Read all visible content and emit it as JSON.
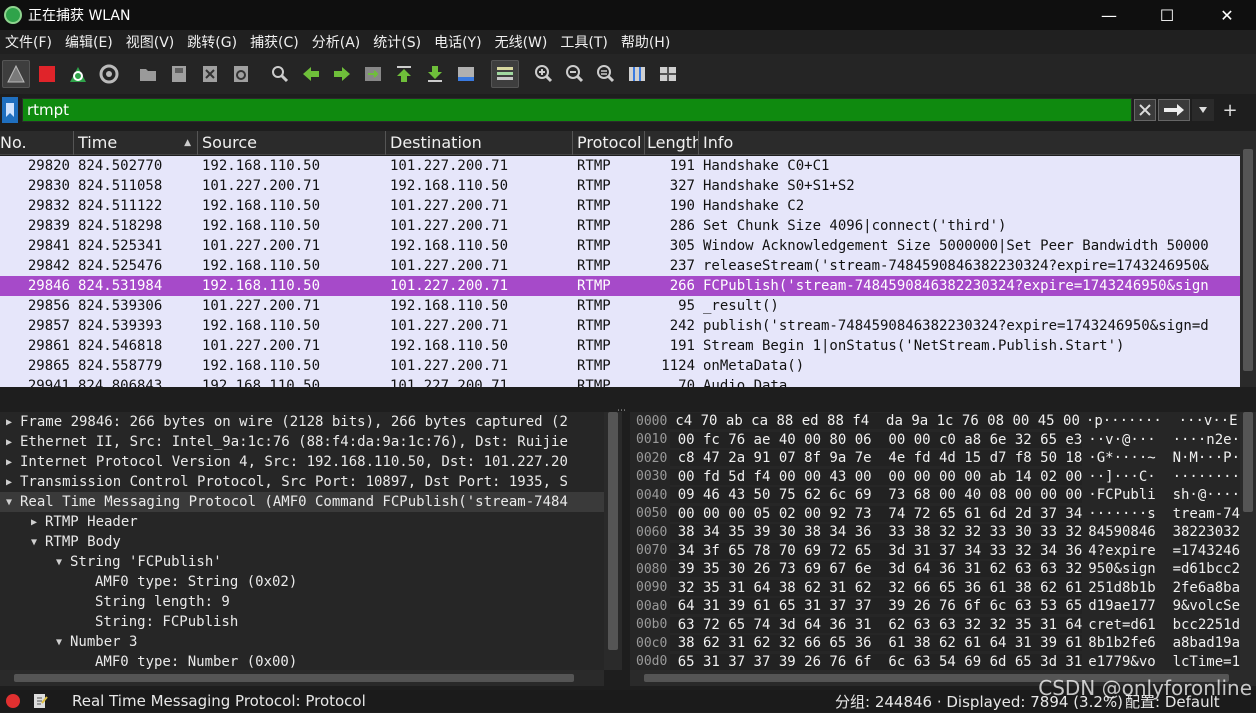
{
  "window": {
    "title": "正在捕获 WLAN",
    "minimize": "—",
    "maximize": "☐",
    "close": "✕"
  },
  "menu": [
    "文件(F)",
    "编辑(E)",
    "视图(V)",
    "跳转(G)",
    "捕获(C)",
    "分析(A)",
    "统计(S)",
    "电话(Y)",
    "无线(W)",
    "工具(T)",
    "帮助(H)"
  ],
  "toolbar": {
    "icons": [
      "shark-fin-icon",
      "stop-capture-icon",
      "restart-capture-icon",
      "capture-options-icon",
      "open-file-icon",
      "save-file-icon",
      "close-file-icon",
      "reload-file-icon",
      "find-packet-icon",
      "go-back-icon",
      "go-forward-icon",
      "go-to-packet-icon",
      "go-first-icon",
      "go-last-icon",
      "auto-scroll-icon",
      "colorize-icon",
      "zoom-in-icon",
      "zoom-out-icon",
      "zoom-reset-icon",
      "resize-columns-icon",
      "layout-icon"
    ]
  },
  "filter": {
    "value": "rtmpt",
    "add_label": "+"
  },
  "packet_list": {
    "columns": [
      "No.",
      "Time",
      "Source",
      "Destination",
      "Protocol",
      "Length",
      "Info"
    ],
    "rows": [
      {
        "no": "29820",
        "time": "824.502770",
        "src": "192.168.110.50",
        "dst": "101.227.200.71",
        "proto": "RTMP",
        "len": "191",
        "info": "Handshake C0+C1"
      },
      {
        "no": "29830",
        "time": "824.511058",
        "src": "101.227.200.71",
        "dst": "192.168.110.50",
        "proto": "RTMP",
        "len": "327",
        "info": "Handshake S0+S1+S2"
      },
      {
        "no": "29832",
        "time": "824.511122",
        "src": "192.168.110.50",
        "dst": "101.227.200.71",
        "proto": "RTMP",
        "len": "190",
        "info": "Handshake C2"
      },
      {
        "no": "29839",
        "time": "824.518298",
        "src": "192.168.110.50",
        "dst": "101.227.200.71",
        "proto": "RTMP",
        "len": "286",
        "info": "Set Chunk Size 4096|connect('third')"
      },
      {
        "no": "29841",
        "time": "824.525341",
        "src": "101.227.200.71",
        "dst": "192.168.110.50",
        "proto": "RTMP",
        "len": "305",
        "info": "Window Acknowledgement Size 5000000|Set Peer Bandwidth 50000"
      },
      {
        "no": "29842",
        "time": "824.525476",
        "src": "192.168.110.50",
        "dst": "101.227.200.71",
        "proto": "RTMP",
        "len": "237",
        "info": "releaseStream('stream-7484590846382230324?expire=1743246950&"
      },
      {
        "no": "29846",
        "time": "824.531984",
        "src": "192.168.110.50",
        "dst": "101.227.200.71",
        "proto": "RTMP",
        "len": "266",
        "info": "FCPublish('stream-7484590846382230324?expire=1743246950&sign",
        "selected": true
      },
      {
        "no": "29856",
        "time": "824.539306",
        "src": "101.227.200.71",
        "dst": "192.168.110.50",
        "proto": "RTMP",
        "len": "95",
        "info": "_result()"
      },
      {
        "no": "29857",
        "time": "824.539393",
        "src": "192.168.110.50",
        "dst": "101.227.200.71",
        "proto": "RTMP",
        "len": "242",
        "info": "publish('stream-7484590846382230324?expire=1743246950&sign=d"
      },
      {
        "no": "29861",
        "time": "824.546818",
        "src": "101.227.200.71",
        "dst": "192.168.110.50",
        "proto": "RTMP",
        "len": "191",
        "info": "Stream Begin 1|onStatus('NetStream.Publish.Start')"
      },
      {
        "no": "29865",
        "time": "824.558779",
        "src": "192.168.110.50",
        "dst": "101.227.200.71",
        "proto": "RTMP",
        "len": "1124",
        "info": "onMetaData()"
      },
      {
        "no": "29941",
        "time": "824.806843",
        "src": "192.168.110.50",
        "dst": "101.227.200.71",
        "proto": "RTMP",
        "len": "70",
        "info": "Audio Data"
      }
    ]
  },
  "details": [
    {
      "level": 0,
      "arrow": "▶",
      "text": "Frame 29846: 266 bytes on wire (2128 bits), 266 bytes captured (2"
    },
    {
      "level": 0,
      "arrow": "▶",
      "text": "Ethernet II, Src: Intel_9a:1c:76 (88:f4:da:9a:1c:76), Dst: Ruijie"
    },
    {
      "level": 0,
      "arrow": "▶",
      "text": "Internet Protocol Version 4, Src: 192.168.110.50, Dst: 101.227.20"
    },
    {
      "level": 0,
      "arrow": "▶",
      "text": "Transmission Control Protocol, Src Port: 10897, Dst Port: 1935, S"
    },
    {
      "level": 0,
      "arrow": "▼",
      "text": "Real Time Messaging Protocol (AMF0 Command FCPublish('stream-7484",
      "selected": true
    },
    {
      "level": 1,
      "arrow": "▶",
      "text": "RTMP Header"
    },
    {
      "level": 1,
      "arrow": "▼",
      "text": "RTMP Body"
    },
    {
      "level": 2,
      "arrow": "▼",
      "text": "String 'FCPublish'"
    },
    {
      "level": 3,
      "arrow": "",
      "text": "AMF0 type: String (0x02)"
    },
    {
      "level": 3,
      "arrow": "",
      "text": "String length: 9"
    },
    {
      "level": 3,
      "arrow": "",
      "text": "String: FCPublish"
    },
    {
      "level": 2,
      "arrow": "▼",
      "text": "Number 3"
    },
    {
      "level": 3,
      "arrow": "",
      "text": "AMF0 type: Number (0x00)"
    }
  ],
  "hex": [
    {
      "off": "0000",
      "bytes": "c4 70 ab ca 88 ed 88 f4  da 9a 1c 76 08 00 45 00",
      "ascii": "·p·······  ···v··E·"
    },
    {
      "off": "0010",
      "bytes": "00 fc 76 ae 40 00 80 06  00 00 c0 a8 6e 32 65 e3",
      "ascii": "··v·@···  ····n2e·"
    },
    {
      "off": "0020",
      "bytes": "c8 47 2a 91 07 8f 9a 7e  4e fd 4d 15 d7 f8 50 18",
      "ascii": "·G*····~  N·M···P·"
    },
    {
      "off": "0030",
      "bytes": "00 fd 5d f4 00 00 43 00  00 00 00 00 ab 14 02 00",
      "ascii": "··]···C·  ········"
    },
    {
      "off": "0040",
      "bytes": "09 46 43 50 75 62 6c 69  73 68 00 40 08 00 00 00",
      "ascii": "·FCPubli  sh·@····"
    },
    {
      "off": "0050",
      "bytes": "00 00 00 05 02 00 92 73  74 72 65 61 6d 2d 37 34",
      "ascii": "·······s  tream-74"
    },
    {
      "off": "0060",
      "bytes": "38 34 35 39 30 38 34 36  33 38 32 32 33 30 33 32",
      "ascii": "84590846  38223032"
    },
    {
      "off": "0070",
      "bytes": "34 3f 65 78 70 69 72 65  3d 31 37 34 33 32 34 36",
      "ascii": "4?expire  =1743246"
    },
    {
      "off": "0080",
      "bytes": "39 35 30 26 73 69 67 6e  3d 64 36 31 62 63 63 32",
      "ascii": "950&sign  =d61bcc2"
    },
    {
      "off": "0090",
      "bytes": "32 35 31 64 38 62 31 62  32 66 65 36 61 38 62 61",
      "ascii": "251d8b1b  2fe6a8ba"
    },
    {
      "off": "00a0",
      "bytes": "64 31 39 61 65 31 37 37  39 26 76 6f 6c 63 53 65",
      "ascii": "d19ae177  9&volcSe"
    },
    {
      "off": "00b0",
      "bytes": "63 72 65 74 3d 64 36 31  62 63 63 32 32 35 31 64",
      "ascii": "cret=d61  bcc2251d"
    },
    {
      "off": "00c0",
      "bytes": "38 62 31 62 32 66 65 36  61 38 62 61 64 31 39 61",
      "ascii": "8b1b2fe6  a8bad19a"
    },
    {
      "off": "00d0",
      "bytes": "65 31 37 37 39 26 76 6f  6c 63 54 69 6d 65 3d 31",
      "ascii": "e1779&vo  lcTime=1"
    }
  ],
  "status": {
    "text": "Real Time Messaging Protocol: Protocol",
    "counts": "分组: 244846 · Displayed: 7894 (3.2%)",
    "profile": "配置: Default"
  },
  "watermark": "CSDN @onlyforonline"
}
